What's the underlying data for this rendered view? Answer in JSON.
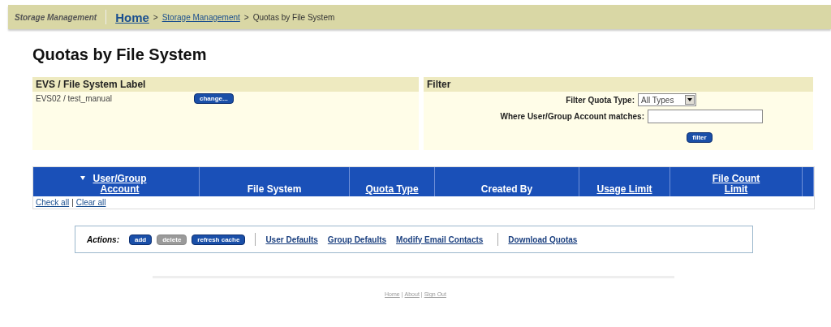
{
  "breadcrumb": {
    "section": "Storage Management",
    "links": [
      "Home",
      "Storage Management"
    ],
    "current": "Quotas by File System",
    "separator": ">"
  },
  "title": "Quotas by File System",
  "evs_panel": {
    "heading": "EVS / File System Label",
    "value": "EVS02 / test_manual",
    "button": "change..."
  },
  "filter_panel": {
    "heading": "Filter",
    "type_label": "Filter Quota Type:",
    "type_value": "All Types",
    "match_label": "Where User/Group Account matches:",
    "button": "filter"
  },
  "table": {
    "columns": [
      {
        "label": "User/Group Account",
        "link": true,
        "sorted": true
      },
      {
        "label": "File System",
        "link": false,
        "sorted": false
      },
      {
        "label": "Quota Type",
        "link": true,
        "sorted": false
      },
      {
        "label": "Created By",
        "link": false,
        "sorted": false
      },
      {
        "label": "Usage Limit",
        "link": true,
        "sorted": false
      },
      {
        "label": "File Count Limit",
        "link": true,
        "sorted": false
      }
    ],
    "select_links": [
      "Check all",
      "Clear all"
    ],
    "link_separator": "|"
  },
  "actions": {
    "label": "Actions:",
    "buttons": [
      {
        "label": "add",
        "disabled": false
      },
      {
        "label": "delete",
        "disabled": true
      },
      {
        "label": "refresh cache",
        "disabled": false
      }
    ],
    "link_groups": [
      [
        "User Defaults",
        "Group Defaults",
        "Modify Email Contacts"
      ],
      [
        "Download Quotas"
      ]
    ]
  },
  "footer_links": [
    "Home",
    "About",
    "Sign Out"
  ],
  "footer_separator": "|"
}
